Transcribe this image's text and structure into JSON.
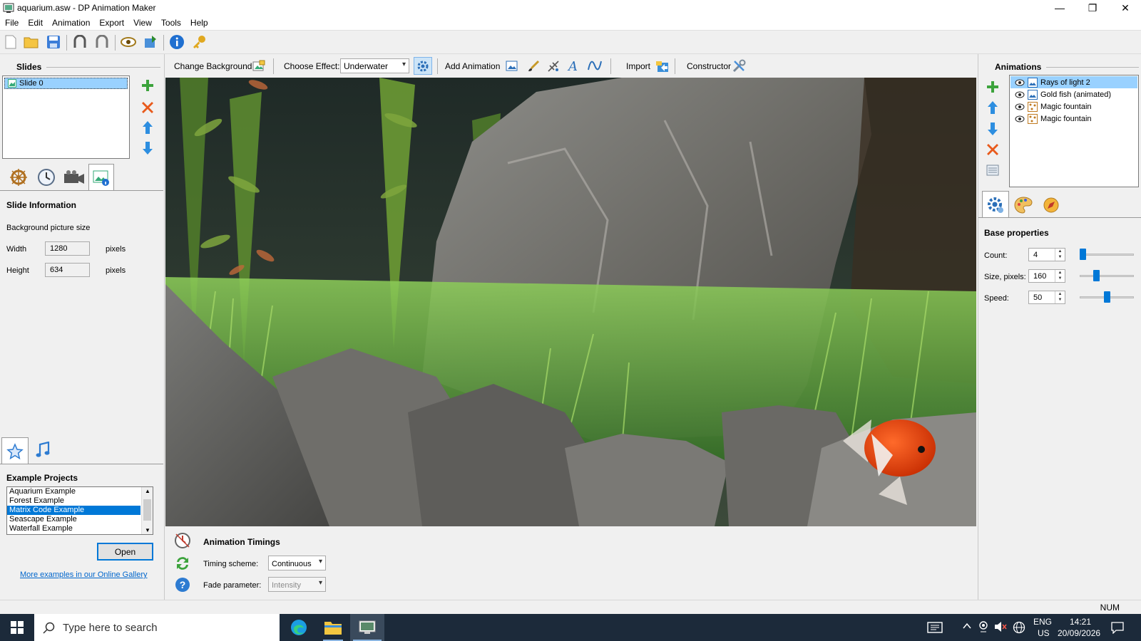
{
  "window": {
    "title": "aquarium.asw - DP Animation Maker",
    "minimize_glyph": "—",
    "restore_glyph": "❐",
    "close_glyph": "✕"
  },
  "menu": [
    "File",
    "Edit",
    "Animation",
    "Export",
    "View",
    "Tools",
    "Help"
  ],
  "toolbar": {
    "icons": [
      "new-file-icon",
      "open-folder-icon",
      "save-icon",
      "undo-icon",
      "redo-icon",
      "preview-eye-icon",
      "export-icon",
      "info-icon",
      "key-icon"
    ]
  },
  "slides_panel": {
    "header": "Slides",
    "items": [
      {
        "label": "Slide 0"
      }
    ],
    "tabs": [
      "settings-wheel-icon",
      "clock-icon",
      "camera-icon",
      "slide-info-icon"
    ],
    "info_title": "Slide Information",
    "bg_size_label": "Background picture size",
    "width_label": "Width",
    "width_value": "1280",
    "height_label": "Height",
    "height_value": "634",
    "unit": "pixels"
  },
  "examples_panel": {
    "tabs": [
      "star-icon",
      "music-note-icon"
    ],
    "header": "Example Projects",
    "items": [
      "Aquarium Example",
      "Forest Example",
      "Matrix Code Example",
      "Seascape Example",
      "Waterfall Example"
    ],
    "selected_index": 2,
    "open_label": "Open",
    "gallery_link": "More examples in our Online Gallery"
  },
  "effect_bar": {
    "change_bg": "Change Background",
    "choose_effect": "Choose Effect:",
    "effect_value": "Underwater",
    "add_animation": "Add Animation",
    "import": "Import",
    "constructor": "Constructor"
  },
  "timings": {
    "title": "Animation Timings",
    "scheme_label": "Timing scheme:",
    "scheme_value": "Continuous",
    "fade_label": "Fade parameter:",
    "fade_value": "Intensity"
  },
  "animations_panel": {
    "header": "Animations",
    "items": [
      {
        "label": "Rays of light 2",
        "selected": true
      },
      {
        "label": "Gold fish (animated)",
        "selected": false
      },
      {
        "label": "Magic fountain",
        "selected": false
      },
      {
        "label": "Magic fountain",
        "selected": false
      }
    ],
    "base_props_title": "Base properties",
    "count_label": "Count:",
    "count_value": "4",
    "size_label": "Size, pixels:",
    "size_value": "160",
    "speed_label": "Speed:",
    "speed_value": "50"
  },
  "status": {
    "num": "NUM"
  },
  "taskbar": {
    "search_placeholder": "Type here to search",
    "lang": "ENG",
    "region": "US",
    "time": "14:21",
    "date": "20/09/2026"
  },
  "colors": {
    "selection": "#99d1ff",
    "list_selection": "#0078d7",
    "taskbar": "#1c2a3a"
  }
}
